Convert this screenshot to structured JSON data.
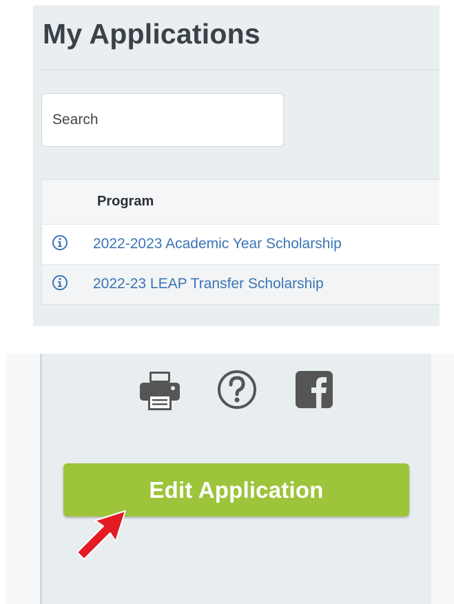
{
  "my_applications": {
    "title": "My Applications",
    "search": {
      "placeholder": "Search",
      "value": ""
    },
    "table": {
      "header": "Program",
      "rows": [
        {
          "icon": "info-icon",
          "label": "2022-2023 Academic Year Scholarship"
        },
        {
          "icon": "info-icon",
          "label": "2022-23 LEAP Transfer Scholarship"
        }
      ]
    }
  },
  "edit_panel": {
    "icons": [
      "printer-icon",
      "help-icon",
      "facebook-icon"
    ],
    "edit_button_label": "Edit Application",
    "annotation": "red-arrow-pointer"
  },
  "colors": {
    "accent_green": "#9dc43a",
    "link_blue": "#3a74b5",
    "title_text": "#3b4148",
    "icon_gray": "#555555",
    "arrow_red": "#e31b23"
  }
}
